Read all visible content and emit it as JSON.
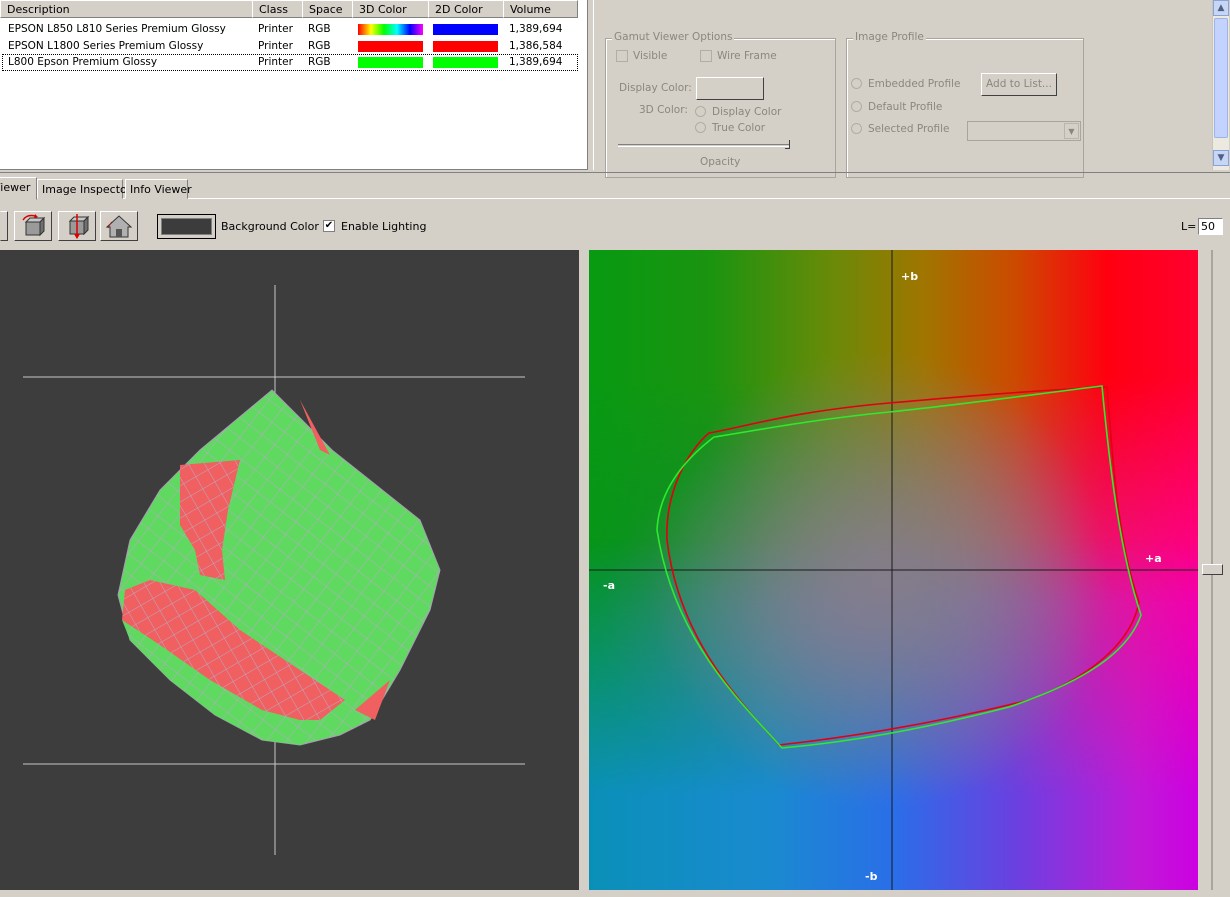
{
  "profile_list": {
    "columns": [
      "Description",
      "Class",
      "Space",
      "3D Color",
      "2D Color",
      "Volume"
    ],
    "rows": [
      {
        "description": "EPSON L850 L810 Series Premium Glossy",
        "class": "Printer",
        "space": "RGB",
        "color3d": "spectrum",
        "color2d": "#0000ff",
        "volume": "1,389,694"
      },
      {
        "description": "EPSON L1800 Series Premium Glossy",
        "class": "Printer",
        "space": "RGB",
        "color3d": "#ff0000",
        "color2d": "#ff0000",
        "volume": "1,386,584"
      },
      {
        "description": "L800 Epson Premium Glossy",
        "class": "Printer",
        "space": "RGB",
        "color3d": "#00ff00",
        "color2d": "#00ff00",
        "volume": "1,389,694"
      }
    ]
  },
  "gamut_options": {
    "title": "Gamut Viewer Options",
    "visible_label": "Visible",
    "wireframe_label": "Wire Frame",
    "display_color_label": "Display Color:",
    "color3d_label": "3D Color:",
    "display_color_radio": "Display Color",
    "true_color_radio": "True Color",
    "opacity_label": "Opacity"
  },
  "image_profile": {
    "title": "Image Profile",
    "embedded_label": "Embedded Profile",
    "add_to_list_label": "Add to List...",
    "default_label": "Default Profile",
    "selected_label": "Selected Profile"
  },
  "tabs": [
    "Viewer",
    "Image Inspector",
    "Info Viewer"
  ],
  "toolbar": {
    "background_color_label": "Background Color",
    "enable_lighting_label": "Enable Lighting",
    "enable_lighting_checked": true,
    "background_color": "#3c3c3c",
    "l_label": "L=",
    "l_value": "50"
  },
  "view2d": {
    "plus_b": "+b",
    "minus_b": "-b",
    "plus_a": "+a",
    "minus_a": "-a"
  }
}
